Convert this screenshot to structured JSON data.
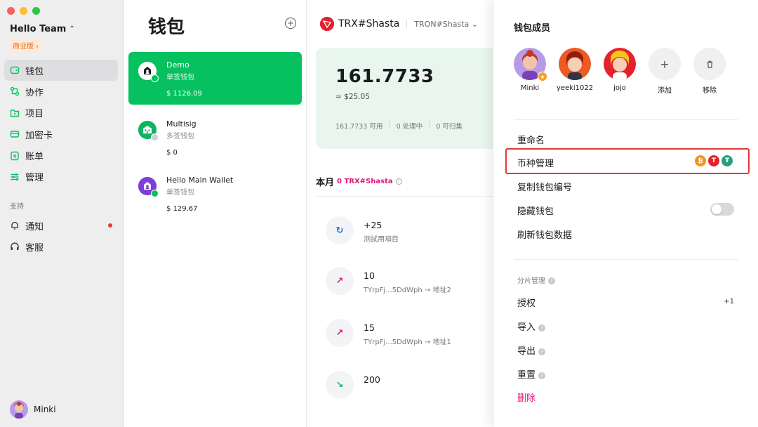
{
  "sidebar": {
    "team_name": "Hello Team",
    "team_toggle": "⌃",
    "plan_badge": "商业版 ›",
    "items": [
      {
        "label": "钱包"
      },
      {
        "label": "协作"
      },
      {
        "label": "项目"
      },
      {
        "label": "加密卡"
      },
      {
        "label": "账单"
      },
      {
        "label": "管理"
      }
    ],
    "support_label": "支持",
    "support_items": [
      {
        "label": "通知"
      },
      {
        "label": "客服"
      }
    ],
    "user_name": "Minki"
  },
  "wallets": {
    "title": "钱包",
    "add_icon": "+",
    "list": [
      {
        "name": "Demo",
        "type": "单签钱包",
        "amount": "$ 1126.09"
      },
      {
        "name": "Multisig",
        "type": "多签钱包",
        "amount": "$ 0"
      },
      {
        "name": "Hello Main Wallet",
        "type": "单签钱包",
        "amount": "$ 129.67"
      }
    ]
  },
  "main": {
    "chain": "TRX#Shasta",
    "network": "TRON#Shasta",
    "network_chevron": "⌄",
    "balance": "161.7733",
    "balance_usd": "≈ $25.05",
    "stats": [
      "161.7733 可用",
      "0 处理中",
      "0 可归集"
    ],
    "stats_sep": "|",
    "month_label": "本月",
    "month_value": "0 TRX#Shasta",
    "info_icon": "i",
    "transactions": [
      {
        "amount": "+25",
        "desc": "测試用項目",
        "glyph": "↻",
        "color": "#1a73e8"
      },
      {
        "amount": "10",
        "desc": "TYrpFj...5DdWph → 地址2",
        "glyph": "↗",
        "color": "#e5157d"
      },
      {
        "amount": "15",
        "desc": "TYrpFj...5DdWph → 地址1",
        "glyph": "↗",
        "color": "#e5157d"
      },
      {
        "amount": "200",
        "desc": "",
        "glyph": "↘",
        "color": "#07c160"
      }
    ]
  },
  "panel": {
    "members_title": "钱包成员",
    "members": [
      {
        "name": "Minki"
      },
      {
        "name": "yeeki1022"
      },
      {
        "name": "jojo"
      }
    ],
    "add_label": "添加",
    "add_glyph": "+",
    "remove_label": "移除",
    "remove_glyph": "🗑",
    "rename": "重命名",
    "coin_manage": "币种管理",
    "copy_id": "复制钱包编号",
    "hide_wallet": "隐藏钱包",
    "refresh": "刷新钱包数据",
    "shard_section": "分片管理",
    "help_glyph": "?",
    "authorize": "授权",
    "authorize_count": "+1",
    "import": "导入",
    "export": "导出",
    "reset": "重置",
    "delete": "删除",
    "coins": [
      {
        "glyph": "₿",
        "color": "#f7931a"
      },
      {
        "glyph": "T",
        "color": "#e3222d"
      },
      {
        "glyph": "₮",
        "color": "#26a17b"
      }
    ]
  }
}
